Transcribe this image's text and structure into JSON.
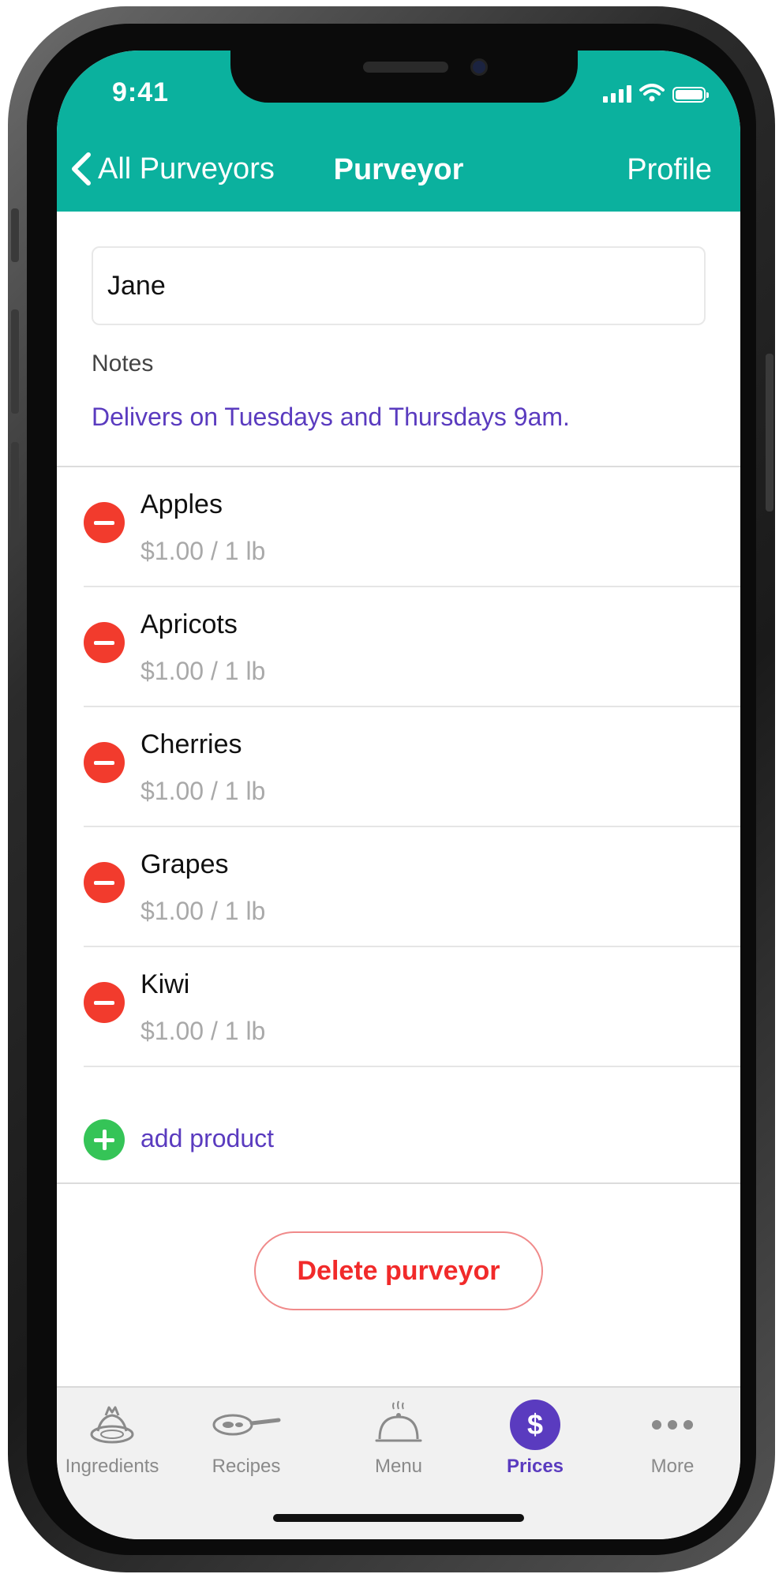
{
  "status_bar": {
    "time": "9:41"
  },
  "nav": {
    "back_label": "All Purveyors",
    "title": "Purveyor",
    "right_label": "Profile"
  },
  "form": {
    "name_value": "Jane",
    "notes_label": "Notes",
    "notes_text": "Delivers on Tuesdays and Thursdays 9am."
  },
  "products": [
    {
      "name": "Apples",
      "price": "$1.00 / 1 lb"
    },
    {
      "name": "Apricots",
      "price": "$1.00 / 1 lb"
    },
    {
      "name": "Cherries",
      "price": "$1.00 / 1 lb"
    },
    {
      "name": "Grapes",
      "price": "$1.00 / 1 lb"
    },
    {
      "name": "Kiwi",
      "price": "$1.00 / 1 lb"
    }
  ],
  "add_product_label": "add product",
  "delete_label": "Delete purveyor",
  "tabs": [
    {
      "label": "Ingredients",
      "icon": "ingredients-icon",
      "active": false
    },
    {
      "label": "Recipes",
      "icon": "pan-icon",
      "active": false
    },
    {
      "label": "Menu",
      "icon": "cloche-icon",
      "active": false
    },
    {
      "label": "Prices",
      "icon": "dollar-icon",
      "active": true,
      "glyph": "$"
    },
    {
      "label": "More",
      "icon": "more-icon",
      "active": false
    }
  ],
  "colors": {
    "header": "#0bb19e",
    "accent_purple": "#5a3bbf",
    "remove_red": "#f23b2d",
    "add_green": "#35c457",
    "delete_red": "#f12a2a"
  }
}
